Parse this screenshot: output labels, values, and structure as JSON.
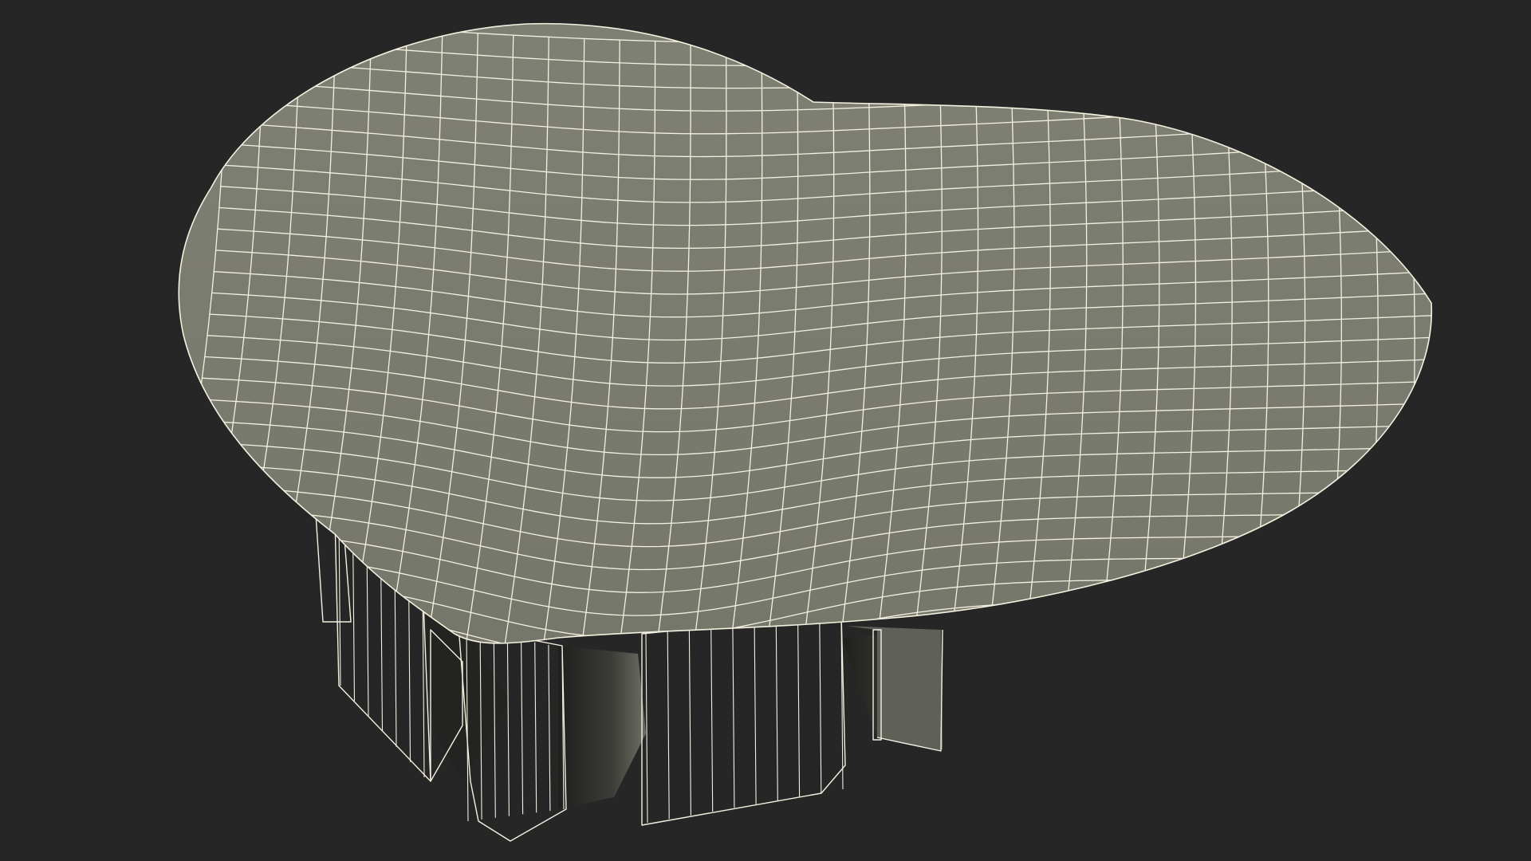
{
  "scene": {
    "subject": "wireframe-mesh-render",
    "colors": {
      "background": "#262626",
      "surface": "#7b7c70",
      "surface_shade": "#6c6d62",
      "surface_dark": "#2b2c28",
      "wire": "#f4f1e0"
    }
  }
}
